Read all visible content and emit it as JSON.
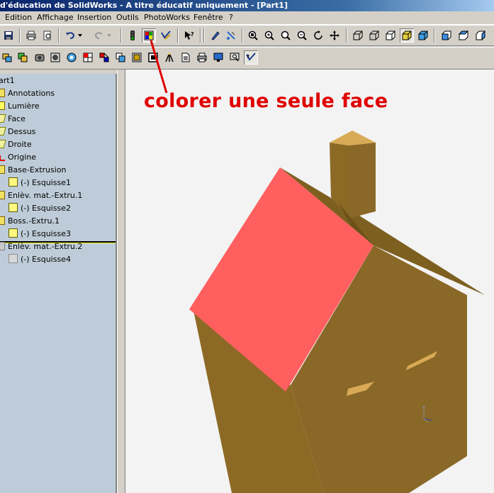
{
  "window": {
    "title": "d'éducation de SolidWorks - A titre éducatif uniquement - [Part1]"
  },
  "menu": {
    "items": [
      {
        "label": "Edition"
      },
      {
        "label": "Affichage"
      },
      {
        "label": "Insertion"
      },
      {
        "label": "Outils"
      },
      {
        "label": "PhotoWorks"
      },
      {
        "label": "Fenêtre"
      },
      {
        "label": "?"
      }
    ]
  },
  "feature_tree": {
    "items": [
      {
        "label": "art1",
        "icon": "part-icon"
      },
      {
        "label": "Annotations",
        "icon": "annotations-folder-icon"
      },
      {
        "label": "Lumière",
        "icon": "lighting-icon"
      },
      {
        "label": "Face",
        "icon": "plane-icon"
      },
      {
        "label": "Dessus",
        "icon": "plane-icon"
      },
      {
        "label": "Droite",
        "icon": "plane-icon"
      },
      {
        "label": "Origine",
        "icon": "origin-icon"
      },
      {
        "label": "Base-Extrusion",
        "icon": "extrude-icon"
      },
      {
        "label": "(-) Esquisse1",
        "icon": "sketch-icon"
      },
      {
        "label": "Enlèv. mat.-Extru.1",
        "icon": "cut-extrude-icon"
      },
      {
        "label": "(-) Esquisse2",
        "icon": "sketch-icon"
      },
      {
        "label": "Boss.-Extru.1",
        "icon": "boss-extrude-icon"
      },
      {
        "label": "(-) Esquisse3",
        "icon": "sketch-icon"
      },
      {
        "label": "Enlèv. mat.-Extru.2",
        "icon": "cut-extrude-icon"
      },
      {
        "label": "(-) Esquisse4",
        "icon": "sketch-icon"
      }
    ]
  },
  "annotation": {
    "text": "colorer une seule face",
    "color": "#e00000"
  },
  "model": {
    "wall_color": "#8c6a25",
    "roof_highlight_color": "#ff5f5f",
    "chimney_top_color": "#d9aa55"
  }
}
